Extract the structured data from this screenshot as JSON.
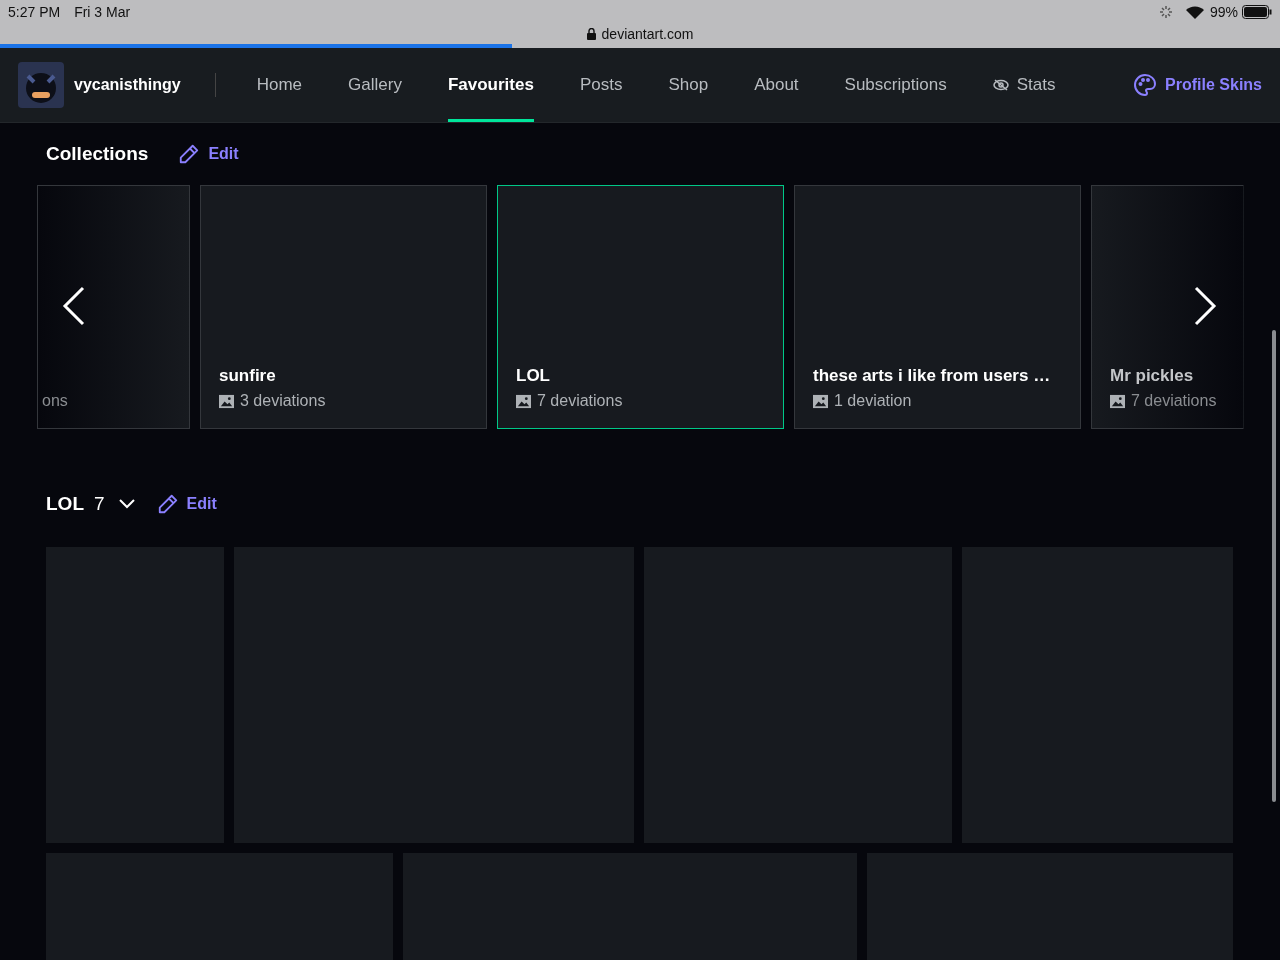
{
  "status_bar": {
    "time": "5:27 PM",
    "date": "Fri 3 Mar",
    "battery": "99%"
  },
  "browser": {
    "url": "deviantart.com",
    "load_progress": {
      "level": 0.4
    }
  },
  "nav": {
    "username": "vycanisthingy",
    "tabs": [
      {
        "label": "Home",
        "selected": false
      },
      {
        "label": "Gallery",
        "selected": false
      },
      {
        "label": "Favourites",
        "selected": true
      },
      {
        "label": "Posts",
        "selected": false
      },
      {
        "label": "Shop",
        "selected": false
      },
      {
        "label": "About",
        "selected": false
      },
      {
        "label": "Subscriptions",
        "selected": false
      },
      {
        "label": "Stats",
        "selected": false,
        "kind": "icon"
      }
    ],
    "profile_skins": "Profile Skins"
  },
  "collections": {
    "title": "Collections",
    "edit": "Edit",
    "items": [
      {
        "count": "ons",
        "selected": false,
        "kind": "partial-left"
      },
      {
        "name": "sunfire",
        "count": "3 deviations",
        "selected": false,
        "kind": "full"
      },
      {
        "name": "LOL",
        "count": "7 deviations",
        "selected": true,
        "kind": "full"
      },
      {
        "name": "these arts i like from users …",
        "count": "1 deviation",
        "selected": false,
        "kind": "full"
      },
      {
        "name": "Mr pickles",
        "count": "7 deviations",
        "selected": false,
        "kind": "partial-right"
      }
    ]
  },
  "folder": {
    "title": "LOL",
    "count": "7",
    "edit": "Edit",
    "rows": [
      {
        "tiles": [
          {
            "kind": "placeholder"
          },
          {
            "kind": "placeholder"
          },
          {
            "kind": "placeholder"
          },
          {
            "kind": "placeholder"
          }
        ]
      },
      {
        "tiles": [
          {
            "kind": "placeholder"
          },
          {
            "kind": "placeholder"
          },
          {
            "kind": "placeholder"
          }
        ]
      }
    ]
  }
}
